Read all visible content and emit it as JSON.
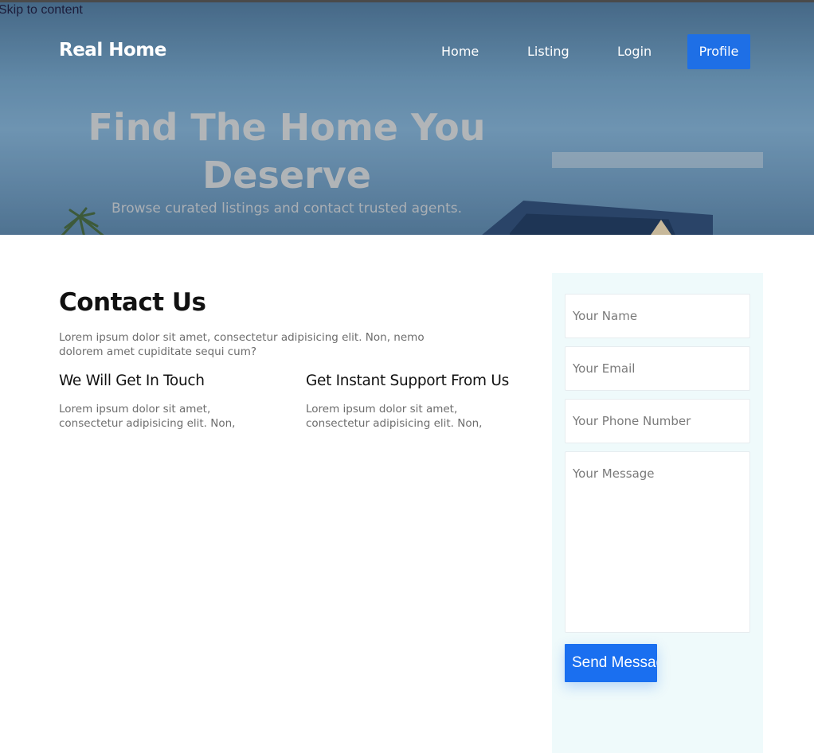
{
  "skip_link": "Skip to content",
  "header": {
    "brand": "Real Home",
    "nav": {
      "home": "Home",
      "listing": "Listing",
      "login": "Login",
      "profile": "Profile"
    }
  },
  "hero": {
    "title": "Find The Home You Deserve",
    "subtitle": "Browse curated listings and contact trusted agents."
  },
  "contact": {
    "title": "Contact Us",
    "intro": "Lorem ipsum dolor sit amet, consectetur adipisicing elit. Non, nemo dolorem amet cupiditate sequi cum?",
    "features": [
      {
        "title": "We Will Get In Touch",
        "text": "Lorem ipsum dolor sit amet, consectetur adipisicing elit. Non,"
      },
      {
        "title": "Get Instant Support From Us",
        "text": "Lorem ipsum dolor sit amet, consectetur adipisicing elit. Non,"
      }
    ]
  },
  "form": {
    "name_placeholder": "Your Name",
    "email_placeholder": "Your Email",
    "phone_placeholder": "Your Phone Number",
    "message_placeholder": "Your Message",
    "send_label": "Send Message"
  },
  "colors": {
    "accent": "#1a6ff0",
    "form_panel_bg": "#effafb"
  }
}
